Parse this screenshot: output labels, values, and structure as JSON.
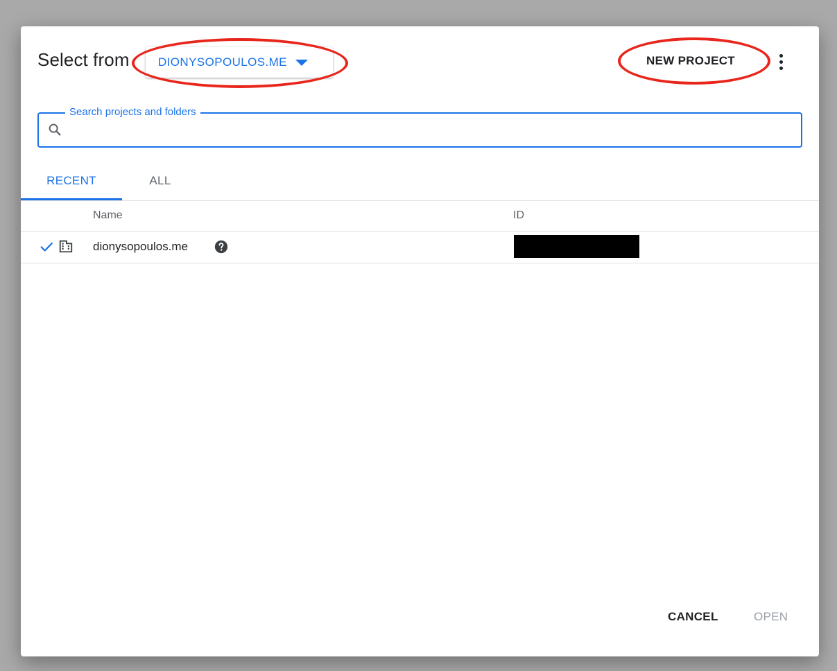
{
  "dialog": {
    "title": "Select from",
    "organization": "DIONYSOPOULOS.ME",
    "new_project_label": "NEW PROJECT"
  },
  "search": {
    "label": "Search projects and folders",
    "value": "",
    "placeholder": ""
  },
  "tabs": [
    {
      "label": "RECENT",
      "active": true
    },
    {
      "label": "ALL",
      "active": false
    }
  ],
  "table": {
    "columns": [
      "Name",
      "ID"
    ],
    "rows": [
      {
        "name": "dionysopoulos.me",
        "selected": true,
        "type_icon": "organization-icon",
        "id_redacted": true
      }
    ]
  },
  "footer": {
    "cancel_label": "CANCEL",
    "open_label": "OPEN"
  },
  "colors": {
    "accent": "#1a73e8",
    "annotation": "#e8261c",
    "disabled": "#9aa0a6"
  },
  "icons": {
    "search": "search-icon",
    "more": "more-vert-icon",
    "check": "check-icon",
    "org": "organization-icon",
    "help": "help-icon",
    "caret": "caret-down-icon"
  }
}
